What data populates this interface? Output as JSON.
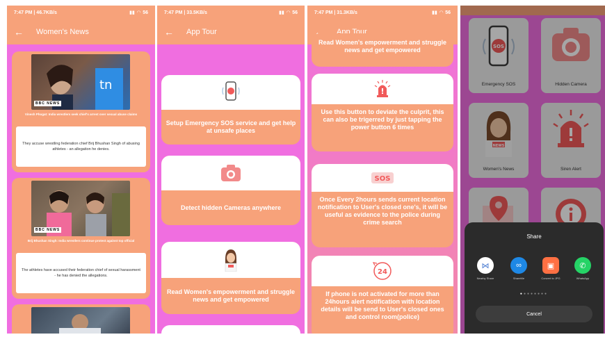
{
  "status": [
    {
      "time": "7:47 PM | 46.7KB/s",
      "battery": "56"
    },
    {
      "time": "7:47 PM | 33.5KB/s",
      "battery": "56"
    },
    {
      "time": "7:47 PM | 31.3KB/s",
      "battery": "56"
    }
  ],
  "screen1": {
    "title": "Women's News",
    "news": [
      {
        "headline": "Vinesh Phogat: India wrestlers seek chief's arrest over sexual abuse claims",
        "summary": "They accuse wrestling federation chief Brij Bhushan Singh of abusing athletes - an allegation he denies."
      },
      {
        "headline": "Brij Bhushan Singh: India wrestlers continue protest against top official",
        "summary": "The athletes have accused their federation chief of sexual harassment - he has denied the allegations."
      }
    ],
    "bbc_label": "BBC NEWS"
  },
  "screen2": {
    "title": "App Tour",
    "cards": [
      "Setup Emergency SOS service and get help at unsafe places",
      "Detect hidden Cameras anywhere",
      "Read Women's empowerment and struggle news and get empowered"
    ]
  },
  "screen3": {
    "title": "App Tour",
    "partial_text": "Read Women's empowerment and struggle news and get empowered",
    "cards": [
      "Use this button to deviate the culprit, this can also be trigerred by just tapping the power button 6 times",
      "Once Every 2hours sends current location notification to User's closed one's, it will be useful as evidence to the police during crime search",
      "If phone is not activated for more than 24hours alert notification with location details will be send to User's closed ones and control room(police)"
    ],
    "sos_label": "SOS",
    "clock_label": "24"
  },
  "screen4": {
    "grid": [
      {
        "label": "Emergency SOS",
        "icon": "sos-phone-icon"
      },
      {
        "label": "Hidden Camera",
        "icon": "camera-icon"
      },
      {
        "label": "Women's News",
        "icon": "news-woman-icon"
      },
      {
        "label": "Siren Alert",
        "icon": "siren-icon"
      }
    ],
    "sos_icon_text": "SOS",
    "news_icon_text": "NEWS",
    "share": {
      "title": "Share",
      "items": [
        {
          "label": "Nearby Share",
          "color": "#ffffff"
        },
        {
          "label": "ShareMe",
          "color": "#1e88e5"
        },
        {
          "label": "Convert to JPG",
          "color": "#ff7043"
        },
        {
          "label": "WhatsApp",
          "color": "#25d366"
        }
      ],
      "cancel": "Cancel"
    }
  }
}
